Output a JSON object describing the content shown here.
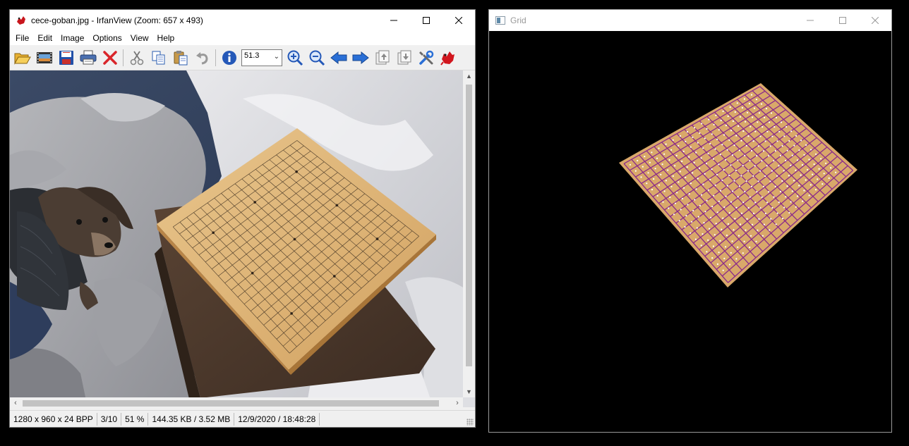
{
  "irfanview": {
    "title": "cece-goban.jpg - IrfanView (Zoom: 657 x 493)",
    "menu": [
      "File",
      "Edit",
      "Image",
      "Options",
      "View",
      "Help"
    ],
    "zoom_value": "51.3",
    "status": {
      "dimensions": "1280 x 960 x 24 BPP",
      "index": "3/10",
      "zoom": "51 %",
      "size": "144.35 KB / 3.52 MB",
      "datetime": "12/9/2020 / 18:48:28"
    },
    "icons": [
      "open-folder-icon",
      "slideshow-icon",
      "save-icon",
      "print-icon",
      "delete-icon",
      "cut-icon",
      "copy-icon",
      "paste-icon",
      "undo-icon",
      "info-icon",
      "zoom-in-icon",
      "zoom-out-icon",
      "previous-icon",
      "next-icon",
      "first-page-icon",
      "last-page-icon",
      "settings-icon",
      "irfanview-logo-icon"
    ]
  },
  "grid_window": {
    "title": "Grid"
  },
  "colors": {
    "board_wood": "#d9a86a",
    "grid_line_purple": "#8a2a8a",
    "window_bg": "#f0f0f0"
  }
}
